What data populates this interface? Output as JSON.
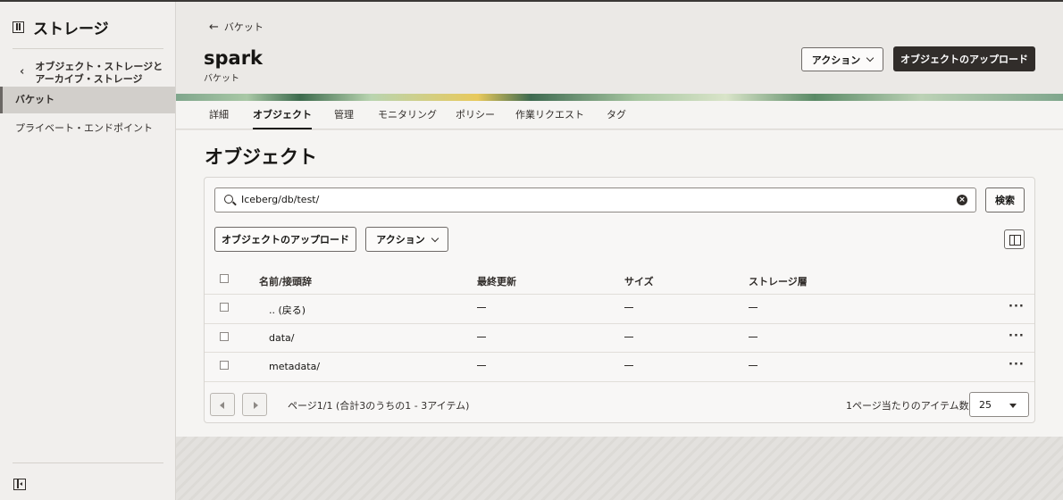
{
  "sidebar": {
    "title": "ストレージ",
    "icon": "storage-panel-icon",
    "back_label_line1": "オブジェクト・ストレージと",
    "back_label_line2": "アーカイブ・ストレージ",
    "items": [
      {
        "label": "バケット",
        "active": true
      },
      {
        "label": "プライベート・エンドポイント",
        "active": false
      }
    ]
  },
  "header": {
    "back_link": "バケット",
    "title": "spark",
    "subtitle": "バケット",
    "actions_button": "アクション",
    "upload_button": "オブジェクトのアップロード"
  },
  "tabs": [
    "詳細",
    "オブジェクト",
    "管理",
    "モニタリング",
    "ポリシー",
    "作業リクエスト",
    "タグ"
  ],
  "active_tab": "オブジェクト",
  "objects": {
    "title": "オブジェクト",
    "search_value": "Iceberg/db/test/",
    "search_button": "検索",
    "upload_button": "オブジェクトのアップロード",
    "actions_button": "アクション",
    "columns": [
      "名前/接頭辞",
      "最終更新",
      "サイズ",
      "ストレージ層"
    ],
    "rows": [
      {
        "name": ".. (戻る)"
      },
      {
        "name": "data/"
      },
      {
        "name": "metadata/"
      }
    ],
    "pagination_text": "ページ1/1 (合計3のうちの1 - 3アイテム)",
    "per_page_label": "1ページ当たりのアイテム数",
    "per_page_value": "25"
  },
  "colors": {
    "primary_button": "#312d2a",
    "background": "#f5f4f2"
  }
}
